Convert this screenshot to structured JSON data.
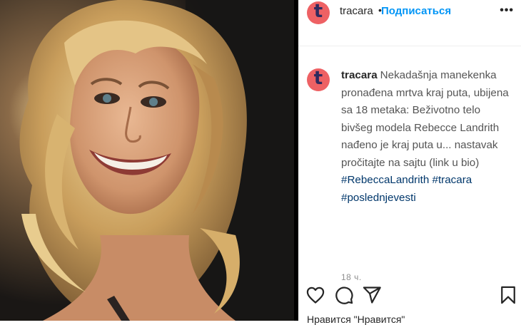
{
  "post": {
    "photo": {
      "description": "Portrait of a smiling woman with wavy blonde hair"
    }
  },
  "header": {
    "avatar_letter": "t",
    "username": "tracara",
    "separator": "•",
    "follow_label": "Подписаться",
    "more_label": "•••"
  },
  "caption": {
    "avatar_letter": "t",
    "username": "tracara",
    "text": "Nekadašnja manekenka pronađena mrtva kraj puta, ubijena sa 18 metaka: Beživotno telo bivšeg modela Rebecce Landrith nađeno je kraj puta u... nastavak pročitajte na sajtu (link u bio)",
    "hashtags": [
      "#RebeccaLandrith",
      "#tracara",
      "#poslednjevesti"
    ],
    "time": "18 ч."
  },
  "actions": {
    "like_icon": "heart-icon",
    "comment_icon": "comment-icon",
    "share_icon": "paper-plane-icon",
    "save_icon": "bookmark-icon",
    "liked_by_text": "Нравится \"Нравится\""
  },
  "colors": {
    "accent": "#0095f6",
    "avatar_bg": "#ee6164",
    "avatar_letter": "#2f2a5e",
    "hashtag": "#00376b"
  }
}
